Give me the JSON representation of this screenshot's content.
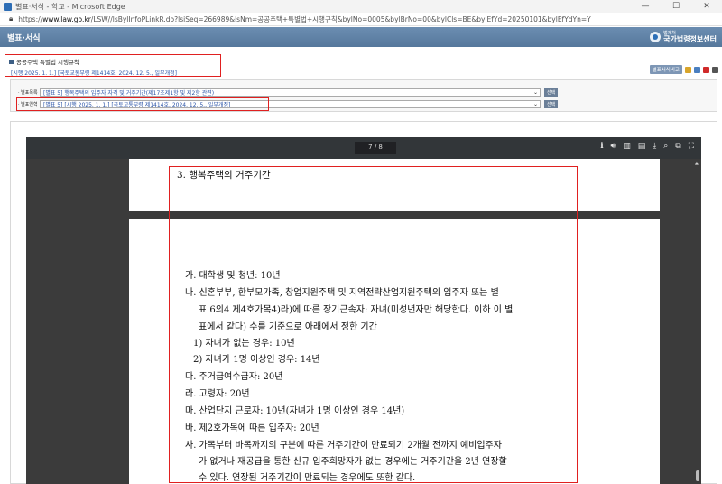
{
  "window": {
    "title": "별표·서식 - 학교 - Microsoft Edge",
    "url_prefix": "https://",
    "url_host": "www.law.go.kr",
    "url_rest": "/LSW//lsBylInfoPLinkR.do?lsiSeq=266989&lsNm=공공주택+특별법+시행규칙&bylNo=0005&bylBrNo=00&bylCls=BE&bylEfYd=20250101&bylEfYdYn=Y"
  },
  "header": {
    "title": "별표·서식",
    "logo_small": "법제처",
    "logo_big": "국가법령정보센터"
  },
  "law": {
    "name": "공공주택 특별법 시행규칙",
    "effective": "[시행 2025. 1. 1.] [국토교통부령 제1414호, 2024. 12. 5., 일부개정]"
  },
  "tools": {
    "compare": "별표서식비교"
  },
  "selectors": {
    "list_label": "· 별표목록",
    "list_value": "[별표 5] 행복주택의 입주자 자격 및 거주기간(제17조제1항 및 제2항 관련)",
    "select_label": "선택",
    "version_label": "· 별표연혁",
    "version_value": "[별표 5] [시행 2025. 1. 1.] [국토교통부령 제1414호, 2024. 12. 5., 일부개정]"
  },
  "viewer": {
    "page_indicator": "7 / 8"
  },
  "document": {
    "heading": "3. 행복주택의 거주기간",
    "lines": [
      "가. 대학생 및 청년: 10년",
      "나. 신혼부부, 한부모가족, 창업지원주택 및 지역전략산업지원주택의 입주자 또는 별",
      "표 6의4 제4호가목4)라)에 따른 장기근속자: 자녀(미성년자만 해당한다. 이하 이 별",
      "표에서 같다) 수를 기준으로 아래에서 정한 기간",
      "1) 자녀가 없는 경우: 10년",
      "2) 자녀가 1명 이상인 경우: 14년",
      "다. 주거급여수급자: 20년",
      "라. 고령자: 20년",
      "마. 산업단지 근로자: 10년(자녀가 1명 이상인 경우 14년)",
      "바. 제2호가목에 따른 입주자: 20년",
      "사. 가목부터 바목까지의 구분에 따른 거주기간이 만료되기 2개월 전까지 예비입주자",
      "가 없거나 재공급을 통한 신규 입주희망자가 없는 경우에는 거주기간을 2년 연장할",
      "수 있다. 연장된 거주기간이 만료되는 경우에도 또한 같다."
    ]
  }
}
